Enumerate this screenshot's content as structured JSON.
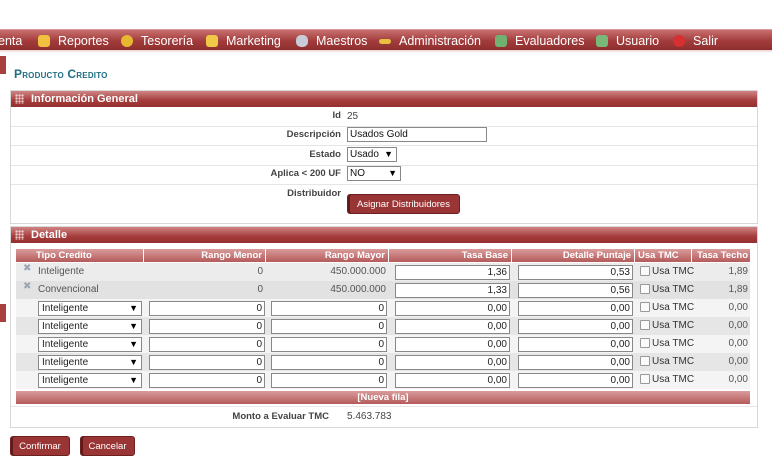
{
  "nav": {
    "items": [
      {
        "label": "enta",
        "icon": "",
        "color": ""
      },
      {
        "label": "Reportes",
        "icon": "folder-icon",
        "color": "#f0c040"
      },
      {
        "label": "Tesorería",
        "icon": "coin-icon",
        "color": "#e8b830"
      },
      {
        "label": "Marketing",
        "icon": "monitor-icon",
        "color": "#f0c848"
      },
      {
        "label": "Maestros",
        "icon": "database-icon",
        "color": "#c8ccd8"
      },
      {
        "label": "Administración",
        "icon": "key-icon",
        "color": "#e8c040"
      },
      {
        "label": "Evaluadores",
        "icon": "gear-icon",
        "color": "#70b070"
      },
      {
        "label": "Usuario",
        "icon": "users-icon",
        "color": "#78b878"
      },
      {
        "label": "Salir",
        "icon": "exit-icon",
        "color": "#d83030"
      }
    ]
  },
  "page": {
    "title": "Producto Credito"
  },
  "general": {
    "header": "Información General",
    "id_label": "Id",
    "id_value": "25",
    "descripcion_label": "Descripción",
    "descripcion_value": "Usados Gold",
    "estado_label": "Estado",
    "estado_value": "Usado",
    "aplica_label": "Aplica < 200 UF",
    "aplica_value": "NO",
    "distribuidor_label": "Distribuidor",
    "asignar_label": "Asignar Distribuidores"
  },
  "detalle": {
    "header": "Detalle",
    "columns": [
      "Tipo Credito",
      "Rango Menor",
      "Rango Mayor",
      "Tasa Base",
      "Detalle Puntaje",
      "Usa TMC",
      "Tasa Techo"
    ],
    "fixed_rows": [
      {
        "tipo": "Inteligente",
        "menor": "0",
        "mayor": "450.000.000",
        "tasa": "1,36",
        "puntaje": "0,53",
        "usa": "Usa TMC",
        "techo": "1,89"
      },
      {
        "tipo": "Convencional",
        "menor": "0",
        "mayor": "450.000.000",
        "tasa": "1,33",
        "puntaje": "0,56",
        "usa": "Usa TMC",
        "techo": "1,89"
      }
    ],
    "edit_rows": [
      {
        "tipo": "Inteligente",
        "menor": "0",
        "mayor": "0",
        "tasa": "0,00",
        "puntaje": "0,00",
        "usa": "Usa TMC",
        "techo": "0,00"
      },
      {
        "tipo": "Inteligente",
        "menor": "0",
        "mayor": "0",
        "tasa": "0,00",
        "puntaje": "0,00",
        "usa": "Usa TMC",
        "techo": "0,00"
      },
      {
        "tipo": "Inteligente",
        "menor": "0",
        "mayor": "0",
        "tasa": "0,00",
        "puntaje": "0,00",
        "usa": "Usa TMC",
        "techo": "0,00"
      },
      {
        "tipo": "Inteligente",
        "menor": "0",
        "mayor": "0",
        "tasa": "0,00",
        "puntaje": "0,00",
        "usa": "Usa TMC",
        "techo": "0,00"
      },
      {
        "tipo": "Inteligente",
        "menor": "0",
        "mayor": "0",
        "tasa": "0,00",
        "puntaje": "0,00",
        "usa": "Usa TMC",
        "techo": "0,00"
      }
    ],
    "nueva_fila": "[Nueva fila]",
    "monto_label": "Monto a Evaluar TMC",
    "monto_value": "5.463.783"
  },
  "actions": {
    "confirmar": "Confirmar",
    "cancelar": "Cancelar"
  }
}
